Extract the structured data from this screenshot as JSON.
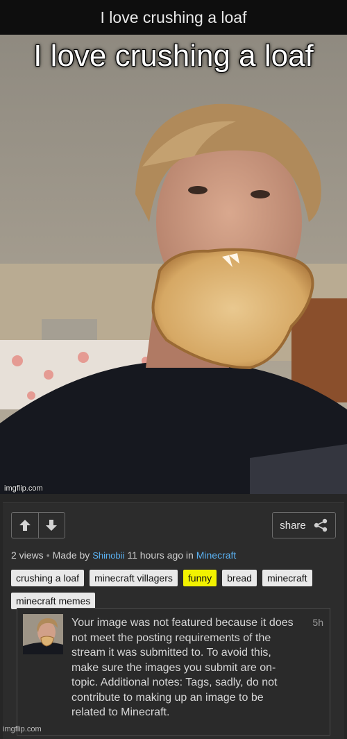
{
  "header": {
    "title": "I love crushing a loaf"
  },
  "meme": {
    "caption": "I love crushing a loaf",
    "watermark": "imgflip.com"
  },
  "actions": {
    "upvote_icon": "arrow-up-icon",
    "downvote_icon": "arrow-down-icon",
    "share_label": "share",
    "share_icon": "share-icon"
  },
  "meta": {
    "views": "2 views",
    "separator": "•",
    "made_by_label": "Made by",
    "author": "Shinobii",
    "time_ago": "11 hours ago in",
    "stream": "Minecraft"
  },
  "tags": [
    {
      "label": "crushing a loaf",
      "highlight": false
    },
    {
      "label": "minecraft villagers",
      "highlight": false
    },
    {
      "label": "funny",
      "highlight": true
    },
    {
      "label": "bread",
      "highlight": false
    },
    {
      "label": "minecraft",
      "highlight": false
    },
    {
      "label": "minecraft memes",
      "highlight": false
    }
  ],
  "notification": {
    "message": "Your image was not featured because it does not meet the posting requirements of the stream it was submitted to. To avoid this, make sure the images you submit are on-topic. Additional notes: Tags, sadly, do not contribute to making up an image to be related to Minecraft.",
    "time": "5h"
  },
  "footer": {
    "watermark": "imgflip.com"
  },
  "colors": {
    "link": "#5ab0f0",
    "tag_highlight": "#f2f200",
    "tag_bg": "#e9e9e9"
  }
}
